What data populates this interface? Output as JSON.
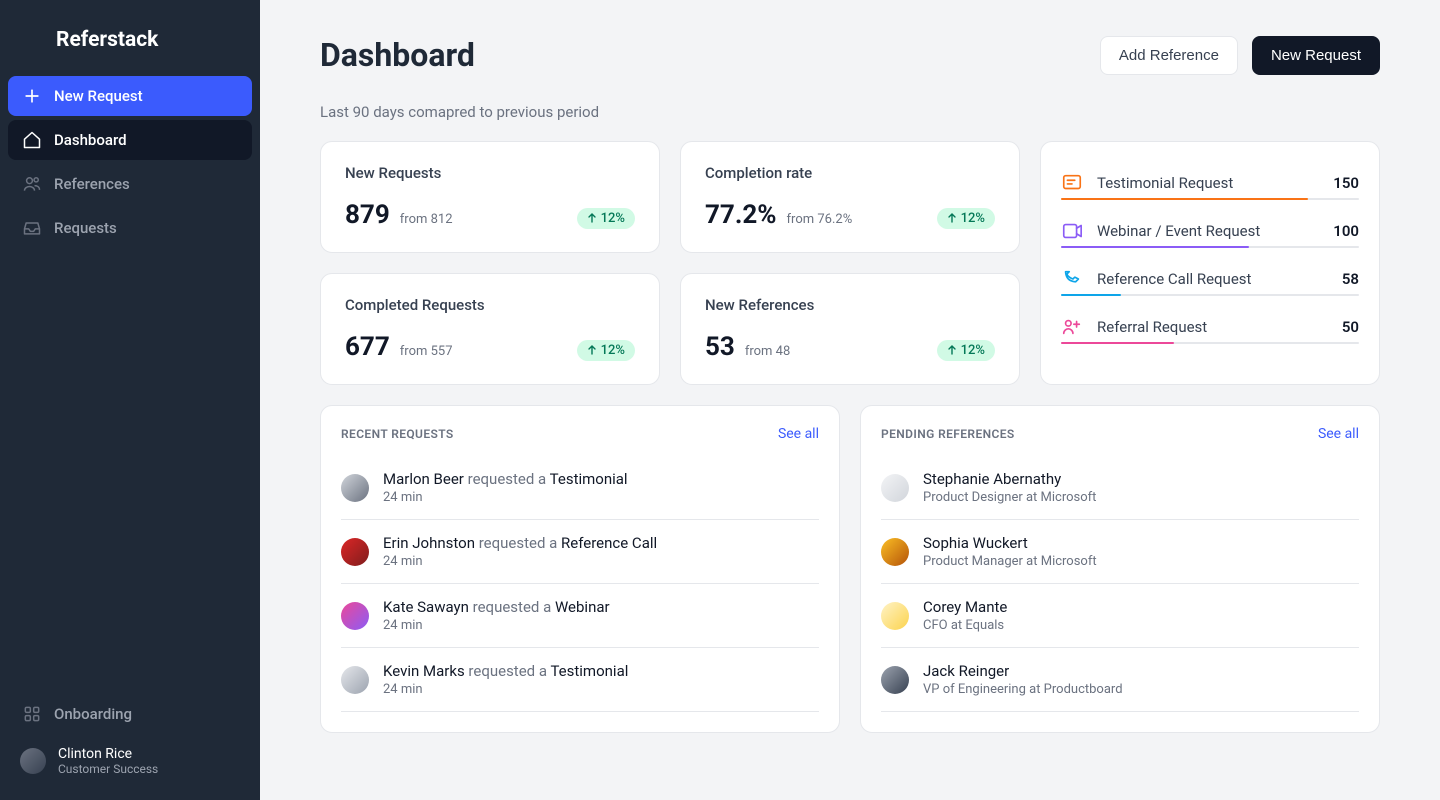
{
  "brand": "Referstack",
  "sidebar": {
    "new_request": "New Request",
    "items": [
      {
        "label": "Dashboard"
      },
      {
        "label": "References"
      },
      {
        "label": "Requests"
      }
    ],
    "onboarding": "Onboarding"
  },
  "user": {
    "name": "Clinton Rice",
    "role": "Customer Success"
  },
  "header": {
    "title": "Dashboard",
    "add_reference": "Add Reference",
    "new_request": "New Request",
    "subhead": "Last 90 days comapred to previous period"
  },
  "stats": [
    {
      "label": "New Requests",
      "value": "879",
      "from": "from 812",
      "change": "12%"
    },
    {
      "label": "Completion rate",
      "value": "77.2%",
      "from": "from 76.2%",
      "change": "12%"
    },
    {
      "label": "Completed Requests",
      "value": "677",
      "from": "from 557",
      "change": "12%"
    },
    {
      "label": "New References",
      "value": "53",
      "from": "from 48",
      "change": "12%"
    }
  ],
  "summary": [
    {
      "label": "Testimonial Request",
      "count": "150",
      "color": "#f97316",
      "pct": 83
    },
    {
      "label": "Webinar / Event Request",
      "count": "100",
      "color": "#8b5cf6",
      "pct": 63
    },
    {
      "label": "Reference Call Request",
      "count": "58",
      "color": "#0ea5e9",
      "pct": 20
    },
    {
      "label": "Referral Request",
      "count": "50",
      "color": "#ec4899",
      "pct": 38
    }
  ],
  "recent": {
    "title": "RECENT REQUESTS",
    "see_all": "See all",
    "items": [
      {
        "name": "Marlon Beer",
        "action": "requested a",
        "type": "Testimonial",
        "time": "24 min",
        "avatar": "g1"
      },
      {
        "name": "Erin Johnston",
        "action": "requested a",
        "type": "Reference Call",
        "time": "24 min",
        "avatar": "g2"
      },
      {
        "name": "Kate Sawayn",
        "action": "requested a",
        "type": "Webinar",
        "time": "24 min",
        "avatar": "g3"
      },
      {
        "name": "Kevin Marks",
        "action": "requested a",
        "type": "Testimonial",
        "time": "24 min",
        "avatar": "g4"
      }
    ]
  },
  "pending": {
    "title": "PENDING REFERENCES",
    "see_all": "See all",
    "items": [
      {
        "name": "Stephanie Abernathy",
        "role": "Product Designer at Microsoft",
        "avatar": "g5"
      },
      {
        "name": "Sophia Wuckert",
        "role": "Product Manager at Microsoft",
        "avatar": "g6"
      },
      {
        "name": "Corey Mante",
        "role": "CFO at Equals",
        "avatar": "g7"
      },
      {
        "name": "Jack Reinger",
        "role": "VP of Engineering at Productboard",
        "avatar": "g8"
      }
    ]
  }
}
